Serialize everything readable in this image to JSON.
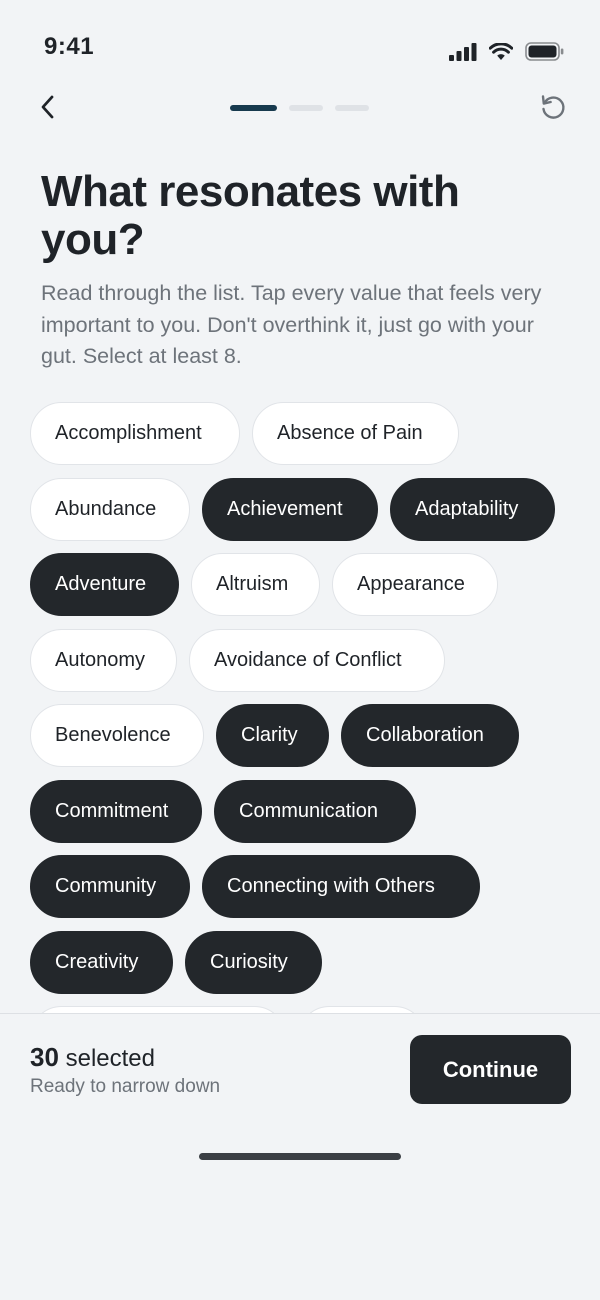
{
  "status_bar": {
    "time": "9:41",
    "icons": [
      "cellular-signal-icon",
      "wifi-icon",
      "battery-icon"
    ]
  },
  "nav": {
    "back_icon": "chevron-left-icon",
    "reset_icon": "reset-icon",
    "progress": {
      "total_steps": 3,
      "current_step": 1
    }
  },
  "header": {
    "title": "What resonates with you?",
    "subtitle": "Read through the list. Tap every value that feels very important to you. Don't overthink it, just go with your gut. Select at least 8."
  },
  "values": [
    [
      {
        "label": "Accomplishment",
        "selected": false
      },
      {
        "label": "Absence of Pain",
        "selected": false
      }
    ],
    [
      {
        "label": "Abundance",
        "selected": false
      },
      {
        "label": "Achievement",
        "selected": true
      },
      {
        "label": "Adaptability",
        "selected": true
      }
    ],
    [
      {
        "label": "Adventure",
        "selected": true
      },
      {
        "label": "Altruism",
        "selected": false
      },
      {
        "label": "Appearance",
        "selected": false
      }
    ],
    [
      {
        "label": "Autonomy",
        "selected": false
      },
      {
        "label": "Avoidance of Conflict",
        "selected": false
      }
    ],
    [
      {
        "label": "Benevolence",
        "selected": false
      },
      {
        "label": "Clarity",
        "selected": true
      },
      {
        "label": "Collaboration",
        "selected": true
      }
    ],
    [
      {
        "label": "Commitment",
        "selected": true
      },
      {
        "label": "Communication",
        "selected": true
      }
    ],
    [
      {
        "label": "Community",
        "selected": true
      },
      {
        "label": "Connecting with Others",
        "selected": true
      }
    ],
    [
      {
        "label": "Creativity",
        "selected": true
      },
      {
        "label": "Curiosity",
        "selected": true
      }
    ],
    [
      {
        "label": "",
        "selected": false
      },
      {
        "label": "",
        "selected": false
      }
    ]
  ],
  "footer": {
    "count": "30",
    "count_suffix": " selected",
    "sub_text": "Ready to narrow down",
    "continue_label": "Continue"
  },
  "colors": {
    "background": "#f2f4f6",
    "chip_selected": "#23272b",
    "chip_unselected": "#ffffff",
    "progress_active": "#173a4e",
    "muted_text": "#6d737a"
  }
}
